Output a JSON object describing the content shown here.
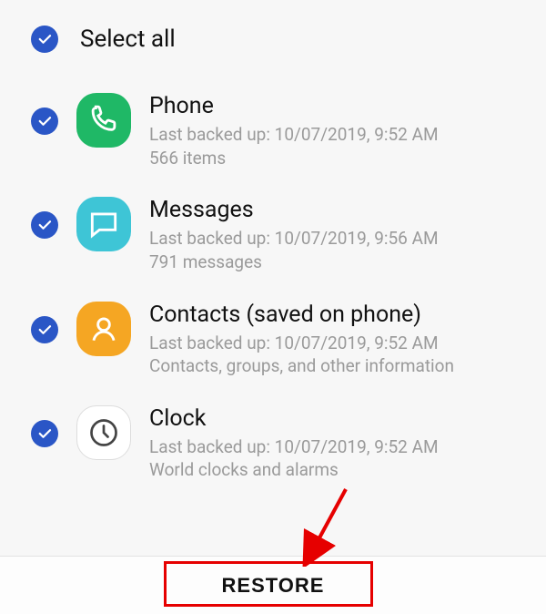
{
  "selectAll": {
    "label": "Select all"
  },
  "items": [
    {
      "title": "Phone",
      "backup": "Last backed up: 10/07/2019, 9:52 AM",
      "detail": "566 items"
    },
    {
      "title": "Messages",
      "backup": "Last backed up: 10/07/2019, 9:56 AM",
      "detail": "791 messages"
    },
    {
      "title": "Contacts (saved on phone)",
      "backup": "Last backed up: 10/07/2019, 9:52 AM",
      "detail": "Contacts, groups, and other information"
    },
    {
      "title": "Clock",
      "backup": "Last backed up: 10/07/2019, 9:52 AM",
      "detail": "World clocks and alarms"
    }
  ],
  "footer": {
    "restore": "RESTORE"
  }
}
